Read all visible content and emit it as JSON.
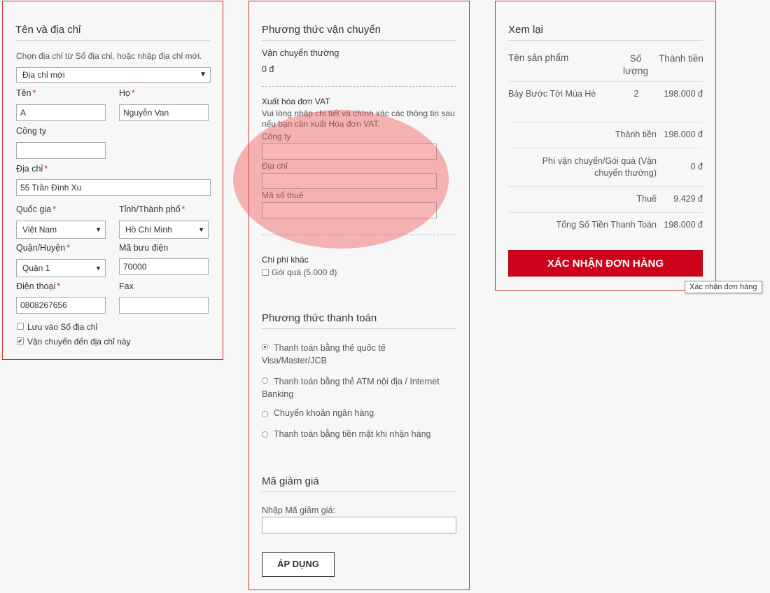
{
  "address": {
    "title": "Tên và địa chỉ",
    "hint": "Chọn địa chỉ từ Sổ địa chỉ, hoặc nhập địa chỉ mới.",
    "address_select": "Địa chỉ mới",
    "first_name_label": "Tên",
    "first_name_value": "A",
    "last_name_label": "Họ",
    "last_name_value": "Nguyễn Van",
    "company_label": "Công ty",
    "company_value": "",
    "street_label": "Địa chỉ",
    "street_value": "55 Trần Đình Xu",
    "country_label": "Quốc gia",
    "country_value": "Việt Nam",
    "city_label": "Tỉnh/Thành phố",
    "city_value": "Hồ Chí Minh",
    "district_label": "Quận/Huyện",
    "district_value": "Quận 1",
    "postcode_label": "Mã bưu điện",
    "postcode_value": "70000",
    "phone_label": "Điện thoại",
    "phone_value": "0808267656",
    "fax_label": "Fax",
    "fax_value": "",
    "save_label": "Lưu vào Sổ địa chỉ",
    "save_checked": false,
    "ship_label": "Vận chuyển đến địa chỉ này",
    "ship_checked": true,
    "required_mark": "*"
  },
  "shipping": {
    "title": "Phương thức vận chuyển",
    "method": "Vận chuyển thường",
    "price": "0 đ",
    "vat_title": "Xuất hóa đơn VAT",
    "vat_hint": "Vui lòng nhập chi tiết và chính xác các thông tin sau nếu bạn cần xuất Hóa đơn VAT.",
    "vat_company_label": "Công ty",
    "vat_address_label": "Địa chỉ",
    "vat_tax_label": "Mã số thuế",
    "other_title": "Chi phí khác",
    "gift_label": "Gói quà (5.000 đ)"
  },
  "payment": {
    "title": "Phương thức thanh toán",
    "options": [
      {
        "label": "Thanh toán bằng thẻ quốc tế Visa/Master/JCB",
        "selected": true
      },
      {
        "label": "Thanh toán bằng thẻ ATM nội địa / Internet Banking",
        "selected": false
      },
      {
        "label": "Chuyển khoản ngân hàng",
        "selected": false
      },
      {
        "label": "Thanh toán bằng tiền mặt khi nhận hàng",
        "selected": false
      }
    ]
  },
  "coupon": {
    "title": "Mã giảm giá",
    "label": "Nhập Mã giảm giá:",
    "value": "",
    "apply_label": "ÁP DỤNG"
  },
  "review": {
    "title": "Xem lại",
    "col_product": "Tên sản phẩm",
    "col_qty": "Số lượng",
    "col_total": "Thành tiền",
    "items": [
      {
        "name": "Bảy Bước Tới Mùa Hè",
        "qty": "2",
        "total": "198.000 đ"
      }
    ],
    "subtotal_label": "Thành tiền",
    "subtotal_value": "198.000 đ",
    "shipping_label": "Phí vận chuyển/Gói quà (Vận chuyển thường)",
    "shipping_value": "0 đ",
    "tax_label": "Thuế",
    "tax_value": "9.429 đ",
    "grand_label": "Tổng Số Tiền Thanh Toán",
    "grand_value": "198.000 đ",
    "confirm_label": "XÁC NHẬN ĐƠN HÀNG",
    "tooltip": "Xác nhận đơn hàng"
  },
  "colors": {
    "accent": "#c9302c",
    "button": "#d0021b",
    "highlight": "#f05050"
  }
}
